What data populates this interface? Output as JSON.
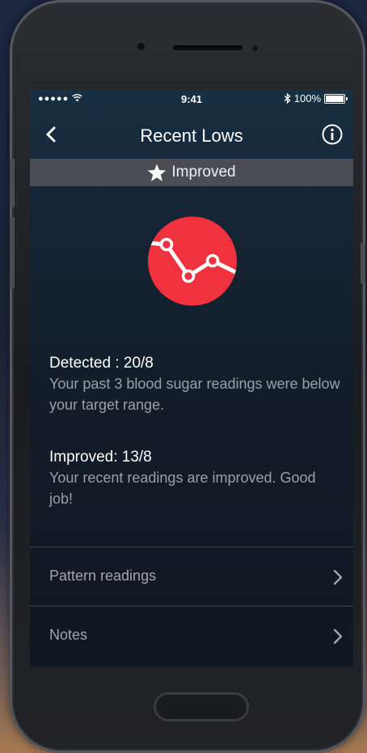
{
  "status_bar": {
    "signal": "●●●●●",
    "time": "9:41",
    "battery_text": "100%"
  },
  "nav": {
    "title": "Recent Lows"
  },
  "banner": {
    "label": "Improved"
  },
  "badge": {
    "color": "#f0323f"
  },
  "detected": {
    "heading": "Detected : 20/8",
    "description": "Your past 3 blood sugar readings were below your target range."
  },
  "improved": {
    "heading": "Improved: 13/8",
    "description": "Your recent readings are improved. Good job!"
  },
  "menu": [
    {
      "label": "Pattern readings"
    },
    {
      "label": "Notes"
    }
  ]
}
